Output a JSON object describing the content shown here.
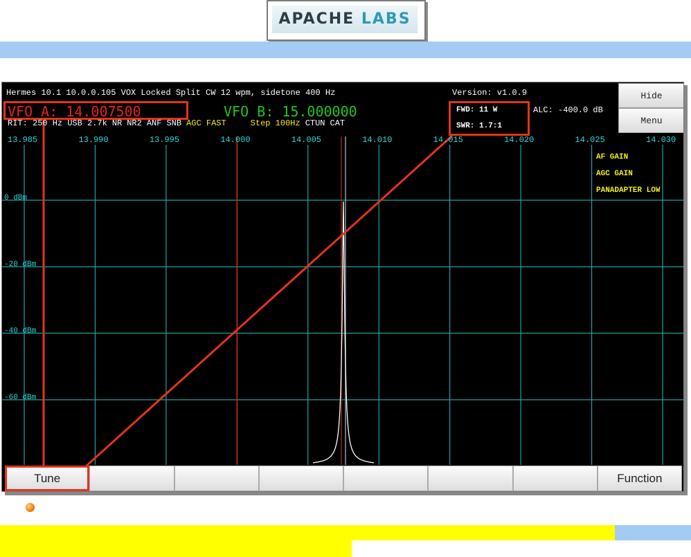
{
  "logo": {
    "part1": "APACHE",
    "part2": "LABS"
  },
  "status_line": "Hermes 10.1 10.0.0.105    VOX  Locked  Split  CW 12 wpm, sidetone 400 Hz",
  "version": "Version: v1.0.9",
  "vfo_a": "VFO A: 14.007500",
  "vfo_b": "VFO B: 15.000000",
  "fwd": "FWD: 11 W",
  "swr": "SWR: 1.7:1",
  "alc": "ALC: -400.0 dB",
  "status2": [
    {
      "text": "RIT: 250 Hz",
      "color": "white"
    },
    {
      "text": "USB 2.7k",
      "color": "white"
    },
    {
      "text": "NR",
      "color": "white"
    },
    {
      "text": "NR2",
      "color": "white"
    },
    {
      "text": "ANF",
      "color": "white"
    },
    {
      "text": "SNB",
      "color": "white"
    },
    {
      "text": "AGC FAST",
      "color": "yellow"
    },
    {
      "text": "Step 100Hz",
      "color": "yellow"
    },
    {
      "text": "CTUN",
      "color": "white"
    },
    {
      "text": "CAT",
      "color": "white"
    }
  ],
  "side_buttons": {
    "hide": "Hide",
    "menu": "Menu"
  },
  "freq_labels": [
    "13.985",
    "13.990",
    "13.995",
    "14.000",
    "14.005",
    "14.010",
    "14.015",
    "14.020",
    "14.025",
    "14.030"
  ],
  "dbm_labels": [
    "0 dBm",
    "-20 dBm",
    "-40 dBm",
    "-60 dBm"
  ],
  "panadapter_menu": [
    "AF GAIN",
    "AGC GAIN",
    "PANADAPTER LOW"
  ],
  "bottom_buttons": [
    "Tune",
    "",
    "",
    "",
    "",
    "",
    "",
    "Function"
  ],
  "colors": {
    "grid": "#1ea5a5",
    "vfo_a_text": "#e8221b",
    "vfo_b_text": "#22c322",
    "highlight": "#e5331c",
    "yellow_text": "#f2ee1e",
    "cyan_labels": "#34d6d6"
  },
  "spectrum": {
    "tx_marker_freq": 14.0075,
    "band_edge_freq": 14.0,
    "peak_freq": 14.0075
  }
}
